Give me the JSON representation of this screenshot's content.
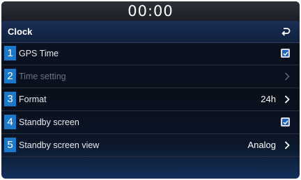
{
  "status_bar": {
    "time": "00:00"
  },
  "header": {
    "title": "Clock",
    "back_icon": "back-return-icon"
  },
  "rows": [
    {
      "number": "1",
      "label": "GPS Time",
      "control": "checkbox",
      "checked": true
    },
    {
      "number": "2",
      "label": "Time setting",
      "control": "chevron",
      "disabled": true
    },
    {
      "number": "3",
      "label": "Format",
      "value": "24h",
      "control": "chevron"
    },
    {
      "number": "4",
      "label": "Standby screen",
      "control": "checkbox",
      "checked": true
    },
    {
      "number": "5",
      "label": "Standby screen view",
      "value": "Analog",
      "control": "chevron"
    }
  ],
  "colors": {
    "badge": "#1e78c8",
    "header": "#1a2f55",
    "check_fill": "#1d63c0"
  }
}
